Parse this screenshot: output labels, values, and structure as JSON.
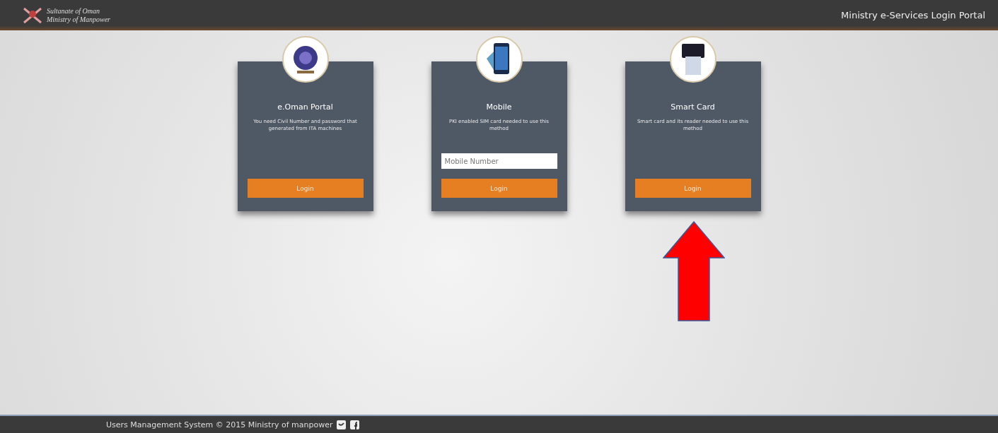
{
  "header": {
    "org_line_1": "Sultanate of Oman",
    "org_line_2": "Ministry of Manpower",
    "title": "Ministry e-Services Login Portal"
  },
  "cards": [
    {
      "kind": "plain",
      "title": "e.Oman Portal",
      "description": "You need Civil Number and password that generated from ITA machines",
      "button": "Login"
    },
    {
      "kind": "input",
      "title": "Mobile",
      "description": "PKI enabled SIM card needed to use this method",
      "placeholder": "Mobile Number",
      "button": "Login"
    },
    {
      "kind": "plain",
      "title": "Smart Card",
      "description": "Smart card and its reader needed to use this method",
      "button": "Login"
    }
  ],
  "footer": {
    "text": "Users Management System © 2015 Ministry of manpower"
  }
}
